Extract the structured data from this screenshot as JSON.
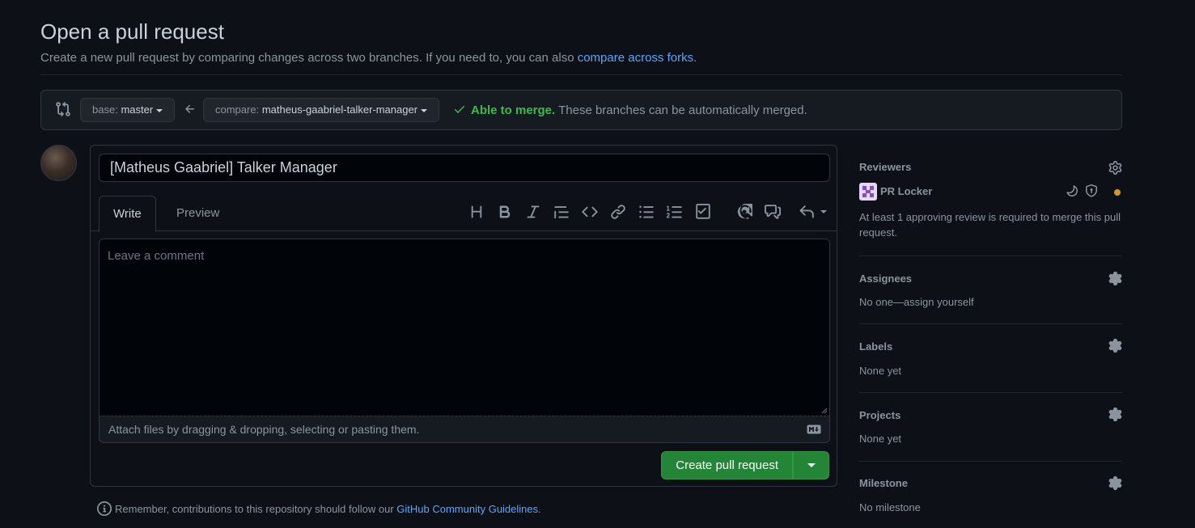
{
  "header": {
    "title": "Open a pull request",
    "subtitle": "Create a new pull request by comparing changes across two branches. If you need to, you can also ",
    "subtitle_link": "compare across forks",
    "subtitle_end": "."
  },
  "branches": {
    "base_prefix": "base:",
    "base_value": "master",
    "compare_prefix": "compare:",
    "compare_value": "matheus-gaabriel-talker-manager",
    "merge_ok": "Able to merge.",
    "merge_text": "These branches can be automatically merged."
  },
  "composer": {
    "title_value": "[Matheus Gaabriel] Talker Manager",
    "tab_write": "Write",
    "tab_preview": "Preview",
    "comment_placeholder": "Leave a comment",
    "attach_text": "Attach files by dragging & dropping, selecting or pasting them.",
    "create_label": "Create pull request",
    "toolbar_icons": [
      "heading-icon",
      "bold-icon",
      "italic-icon",
      "quote-icon",
      "code-icon",
      "link-icon",
      "unordered-list-icon",
      "ordered-list-icon",
      "task-list-icon",
      "mention-icon",
      "reference-icon",
      "reply-icon"
    ]
  },
  "guidelines": {
    "text": "Remember, contributions to this repository should follow our ",
    "link": "GitHub Community Guidelines",
    "end": "."
  },
  "sidebar": {
    "reviewers": {
      "heading": "Reviewers",
      "reviewer_name": "PR Locker",
      "note": "At least 1 approving review is required to merge this pull request."
    },
    "assignees": {
      "heading": "Assignees",
      "value": "No one—assign yourself"
    },
    "labels": {
      "heading": "Labels",
      "value": "None yet"
    },
    "projects": {
      "heading": "Projects",
      "value": "None yet"
    },
    "milestone": {
      "heading": "Milestone",
      "value": "No milestone"
    }
  },
  "colors": {
    "background": "#0d1117",
    "accent_link": "#58a6ff",
    "success": "#3fb950",
    "primary_button": "#238636",
    "pending_dot": "#d29922"
  }
}
